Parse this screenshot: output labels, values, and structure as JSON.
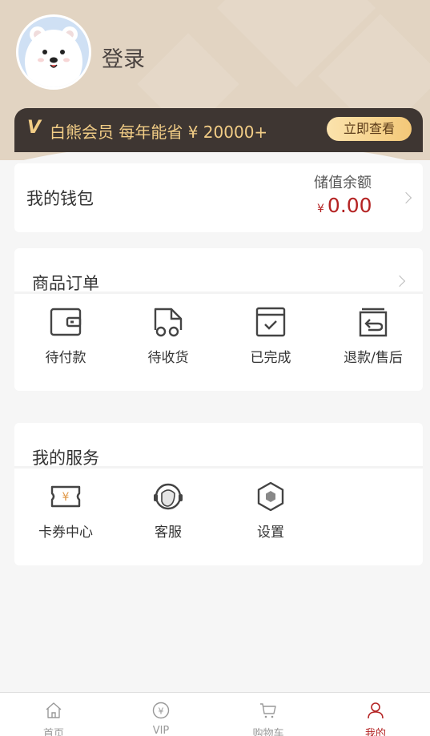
{
  "header": {
    "login_label": "登录",
    "vip_logo": "V",
    "vip_text": "白熊会员 每年能省 ¥ 20000+",
    "vip_button": "立即查看"
  },
  "wallet": {
    "title": "我的钱包",
    "balance_label": "储值余额",
    "currency": "¥",
    "balance": "0.00"
  },
  "orders": {
    "title": "商品订单",
    "items": [
      {
        "label": "待付款",
        "icon": "wallet-icon"
      },
      {
        "label": "待收货",
        "icon": "truck-icon"
      },
      {
        "label": "已完成",
        "icon": "check-box-icon"
      },
      {
        "label": "退款/售后",
        "icon": "return-box-icon"
      }
    ]
  },
  "services": {
    "title": "我的服务",
    "items": [
      {
        "label": "卡券中心",
        "icon": "coupon-icon"
      },
      {
        "label": "客服",
        "icon": "headset-icon"
      },
      {
        "label": "设置",
        "icon": "hexagon-settings-icon"
      }
    ]
  },
  "tabbar": {
    "items": [
      {
        "label": "首页",
        "icon": "home-icon"
      },
      {
        "label": "VIP",
        "icon": "yen-circle-icon"
      },
      {
        "label": "购物车",
        "icon": "cart-icon"
      },
      {
        "label": "我的",
        "icon": "user-icon"
      }
    ],
    "active_index": 3
  },
  "colors": {
    "accent": "#b42323",
    "gold": "#f2cd86",
    "vip_bar": "#3e3632",
    "header_bg": "#e2d4c2"
  }
}
